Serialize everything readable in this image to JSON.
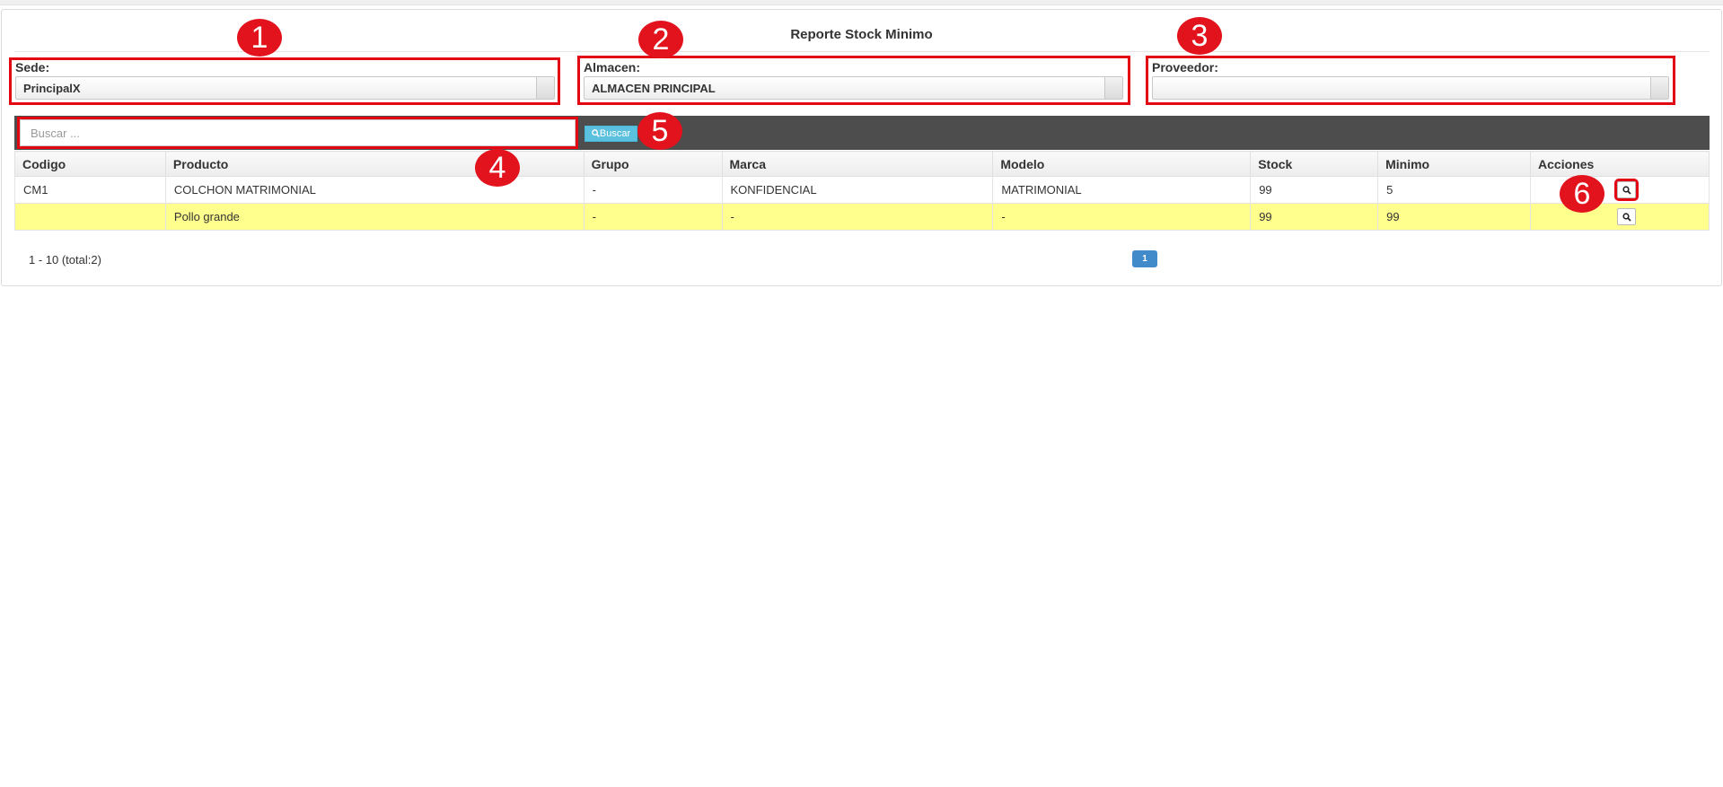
{
  "page": {
    "title": "Reporte Stock Minimo"
  },
  "filters": {
    "sede": {
      "label": "Sede:",
      "value": "PrincipalX"
    },
    "almacen": {
      "label": "Almacen:",
      "value": "ALMACEN PRINCIPAL"
    },
    "proveedor": {
      "label": "Proveedor:",
      "value": ""
    }
  },
  "search": {
    "placeholder": "Buscar ...",
    "button_label": "Buscar"
  },
  "table": {
    "headers": [
      "Codigo",
      "Producto",
      "Grupo",
      "Marca",
      "Modelo",
      "Stock",
      "Minimo",
      "Acciones"
    ],
    "rows": [
      {
        "codigo": "CM1",
        "producto": "COLCHON MATRIMONIAL",
        "grupo": "-",
        "marca": "KONFIDENCIAL",
        "modelo": "MATRIMONIAL",
        "stock": "99",
        "minimo": "5"
      },
      {
        "codigo": "",
        "producto": "Pollo grande",
        "grupo": "-",
        "marca": "-",
        "modelo": "-",
        "stock": "99",
        "minimo": "99"
      }
    ]
  },
  "pagination": {
    "range": "1 - 10 (total:2)",
    "current_page": "1"
  },
  "annotations": [
    "1",
    "2",
    "3",
    "4",
    "5",
    "6"
  ],
  "colors": {
    "annotation_red": "#e2131c",
    "highlight_row": "#ffff8d",
    "toolbar": "#4d4d4d",
    "button_info": "#5bc0de",
    "page_active": "#428bca"
  },
  "icons": {
    "search": "search-icon",
    "view": "magnifier-icon"
  }
}
